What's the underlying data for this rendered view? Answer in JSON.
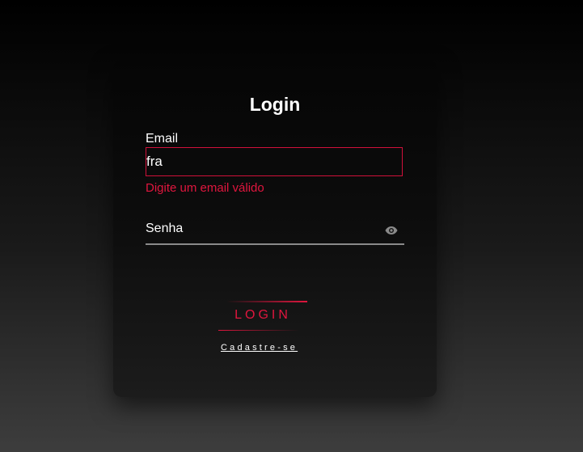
{
  "login_form": {
    "title": "Login",
    "email": {
      "label": "Email",
      "value": "fra",
      "error": "Digite um email válido",
      "error_color": "#e0163e"
    },
    "password": {
      "placeholder": "Senha",
      "toggle_icon": "eye-icon"
    },
    "submit_label": "LOGIN",
    "signup_label": "Cadastre-se",
    "accent_color": "#e0163e"
  }
}
